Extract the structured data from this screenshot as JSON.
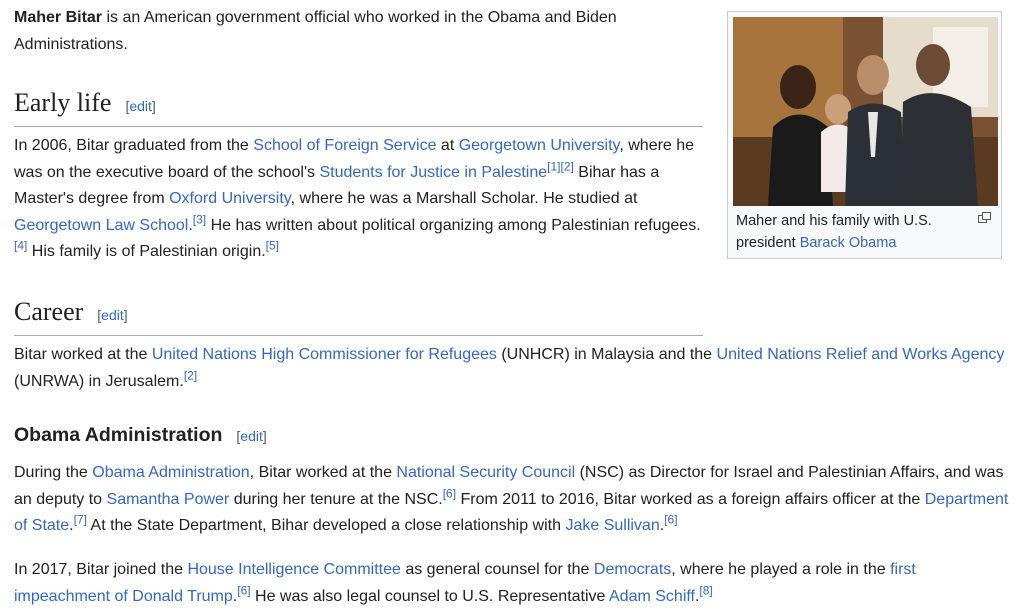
{
  "intro": {
    "subject_bold": "Maher Bitar",
    "text": " is an American government official who worked in the Obama and Biden Administrations."
  },
  "edit": {
    "open": "[",
    "label": "edit",
    "close": "]"
  },
  "sections": {
    "early_life": {
      "heading": "Early life",
      "t1": "In 2006, Bitar graduated from the ",
      "l1": "School of Foreign Service",
      "t2": " at ",
      "l2": "Georgetown University",
      "t3": ", where he was on the executive board of the school's ",
      "l3": "Students for Justice in Palestine",
      "c1": "[1]",
      "c2": "[2]",
      "t4": " Bihar has a Master's degree from ",
      "l4": "Oxford University",
      "t5": ", where he was a Marshall Scholar. He studied at ",
      "l5": "Georgetown Law School",
      "t6": ".",
      "c3": "[3]",
      "t7": " He has written about political organizing among Palestinian refugees.",
      "c4": "[4]",
      "t8": " His family is of Palestinian origin.",
      "c5": "[5]"
    },
    "career": {
      "heading": "Career",
      "t1": "Bitar worked at the ",
      "l1": "United Nations High Commissioner for Refugees",
      "t2": " (UNHCR) in Malaysia and the ",
      "l2": "United Nations Relief and Works Agency",
      "t3": " (UNRWA) in Jerusalem.",
      "c1": "[2]"
    },
    "obama": {
      "heading": "Obama Administration",
      "p1": {
        "t1": "During the ",
        "l1": "Obama Administration",
        "t2": ", Bitar worked at the ",
        "l2": "National Security Council",
        "t3": " (NSC) as Director for Israel and Palestinian Affairs, and was an deputy to ",
        "l3": "Samantha Power",
        "t4": " during her tenure at the NSC.",
        "c1": "[6]",
        "t5": " From 2011 to 2016, Bitar worked as a foreign affairs officer at the ",
        "l4": "Department of State",
        "t6": ".",
        "c2": "[7]",
        "t7": " At the State Department, Bihar developed a close relationship with ",
        "l5": "Jake Sullivan",
        "t8": ".",
        "c3": "[6]"
      },
      "p2": {
        "t1": "In 2017, Bitar joined the ",
        "l1": "House Intelligence Committee",
        "t2": " as general counsel for the ",
        "l2": "Democrats",
        "t3": ", where he played a role in the ",
        "l3": "first impeachment of Donald Trump",
        "t4": ".",
        "c1": "[6]",
        "t5": " He was also legal counsel to U.S. Representative ",
        "l4": "Adam Schiff",
        "t6": ".",
        "c2": "[8]"
      }
    }
  },
  "thumbnail": {
    "caption_text": "Maher and his family with U.S. president ",
    "caption_link": "Barack Obama",
    "magnify_icon": "enlarge-icon"
  }
}
